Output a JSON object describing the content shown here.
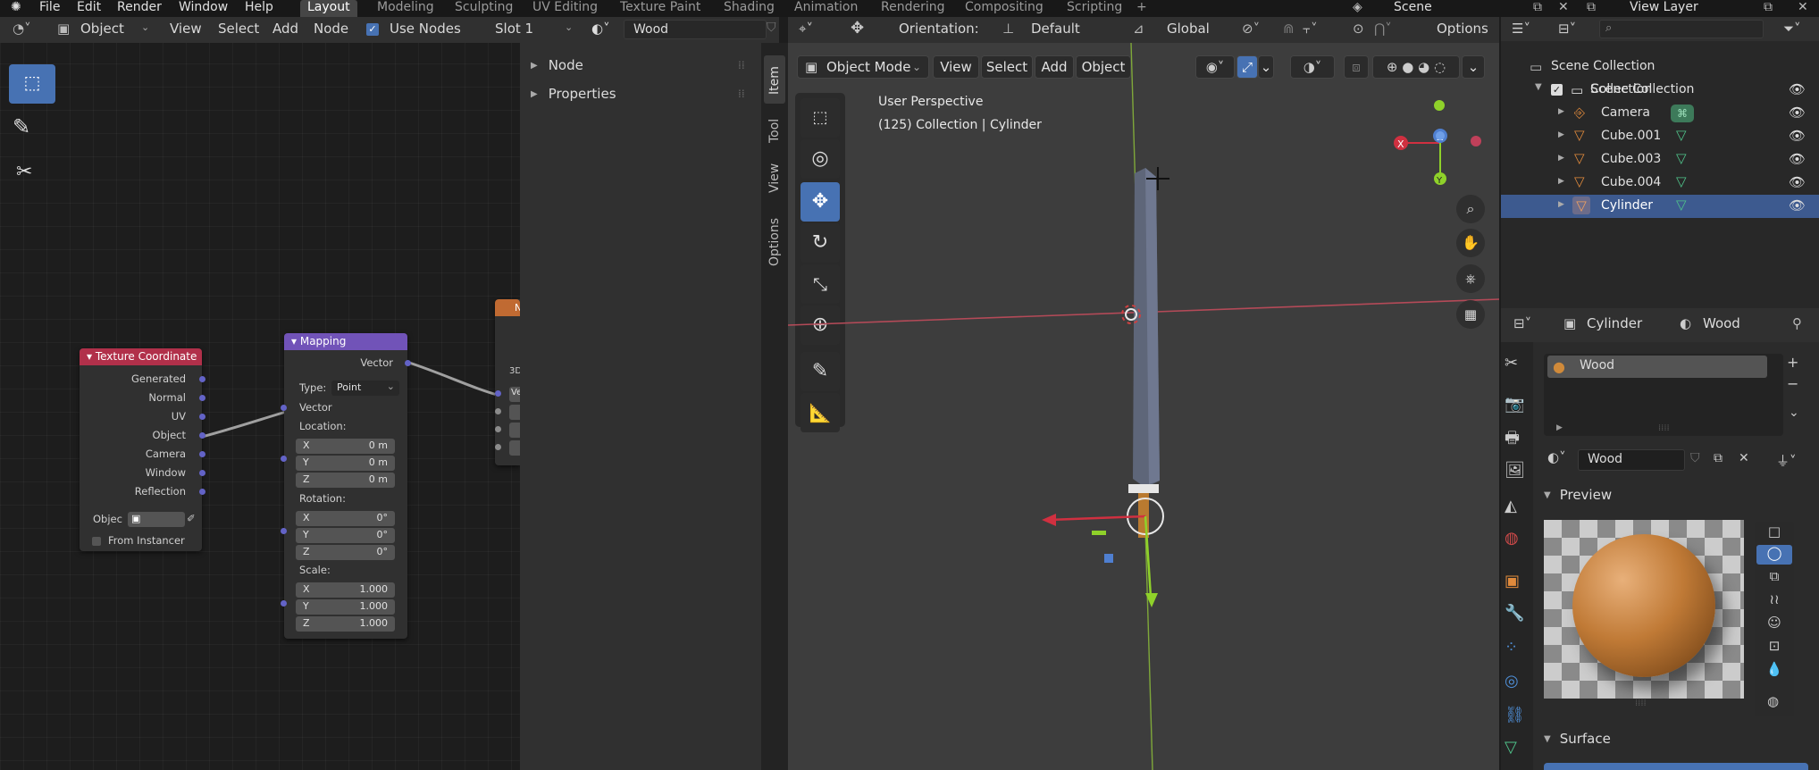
{
  "menu": {
    "file": "File",
    "edit": "Edit",
    "render": "Render",
    "window": "Window",
    "help": "Help"
  },
  "workspaces": [
    "Layout",
    "Modeling",
    "Sculpting",
    "UV Editing",
    "Texture Paint",
    "Shading",
    "Animation",
    "Rendering",
    "Compositing",
    "Scripting",
    "+"
  ],
  "scene": "Scene",
  "view_layer": "View Layer",
  "node_editor": {
    "object_label": "Object",
    "view": "View",
    "select": "Select",
    "add": "Add",
    "node": "Node",
    "use_nodes": "Use Nodes",
    "slot": "Slot 1",
    "material": "Wood"
  },
  "side_panel": {
    "node": "Node",
    "properties": "Properties",
    "tabs": [
      "Item",
      "Tool",
      "View",
      "Options"
    ]
  },
  "tex_coord": {
    "title": "Texture Coordinate",
    "outputs": [
      "Generated",
      "Normal",
      "UV",
      "Object",
      "Camera",
      "Window",
      "Reflection"
    ],
    "object_label": "Objec",
    "from_instancer": "From Instancer"
  },
  "mapping": {
    "title": "Mapping",
    "output": "Vector",
    "type_label": "Type:",
    "type_value": "Point",
    "vector": "Vector",
    "location": "Location:",
    "rotation": "Rotation:",
    "scale": "Scale:",
    "loc": [
      [
        "X",
        "0 m"
      ],
      [
        "Y",
        "0 m"
      ],
      [
        "Z",
        "0 m"
      ]
    ],
    "rot": [
      [
        "X",
        "0°"
      ],
      [
        "Y",
        "0°"
      ],
      [
        "Z",
        "0°"
      ]
    ],
    "scl": [
      [
        "X",
        "1.000"
      ],
      [
        "Y",
        "1.000"
      ],
      [
        "Z",
        "1.000"
      ]
    ]
  },
  "partial_node": {
    "title": "N",
    "row": "3D",
    "row2": "Ve"
  },
  "viewport": {
    "orientation_label": "Orientation:",
    "orientation": "Default",
    "global": "Global",
    "options": "Options",
    "mode": "Object Mode",
    "view": "View",
    "select": "Select",
    "add": "Add",
    "object": "Object",
    "perspective": "User Perspective",
    "collection_info": "(125) Collection | Cylinder"
  },
  "outliner": {
    "search": "",
    "scene_collection": "Scene Collection",
    "collection": "Collection",
    "items": [
      "Camera",
      "Cube.001",
      "Cube.003",
      "Cube.004",
      "Cylinder"
    ]
  },
  "properties": {
    "object": "Cylinder",
    "material": "Wood",
    "slot": "Wood",
    "mat_name": "Wood",
    "preview": "Preview",
    "surface": "Surface"
  },
  "colors": {
    "accent": "#4772b3",
    "tex_coord_header": "#b1304a",
    "mapping_header": "#7153b8",
    "partial_header": "#c06a32"
  }
}
